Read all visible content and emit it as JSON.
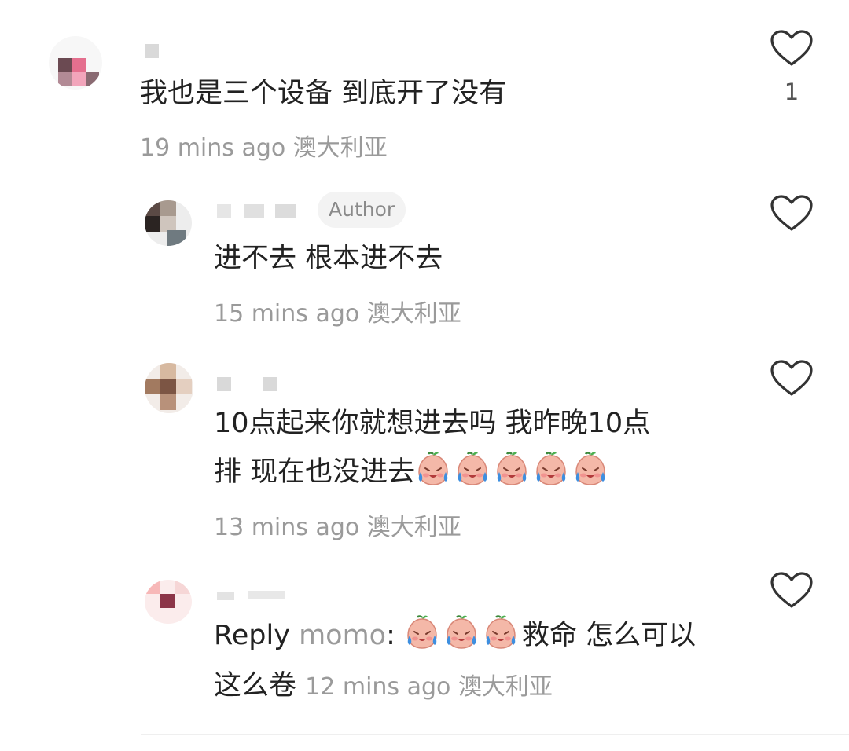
{
  "comments": [
    {
      "text": "我也是三个设备 到底开了没有",
      "time": "19 mins ago",
      "location": "澳大利亚",
      "likes": "1"
    },
    {
      "badge": "Author",
      "text": "进不去 根本进不去",
      "time": "15 mins ago",
      "location": "澳大利亚"
    },
    {
      "text_line1": "10点起来你就想进去吗 我昨晚10点",
      "text_line2": "排 现在也没进去",
      "time": "13 mins ago",
      "location": "澳大利亚"
    },
    {
      "reply_label": "Reply",
      "reply_to": "momo",
      "colon": ":",
      "text_part1": "救命 怎么可以",
      "text_line2": "这么卷",
      "time": "12 mins ago",
      "location": "澳大利亚"
    }
  ],
  "icons": {
    "like": "heart-outline-icon",
    "emoji": "crying-peach-emoji"
  },
  "colors": {
    "text": "#222222",
    "meta": "#9a9a9a",
    "badge_bg": "#f3f3f3"
  }
}
